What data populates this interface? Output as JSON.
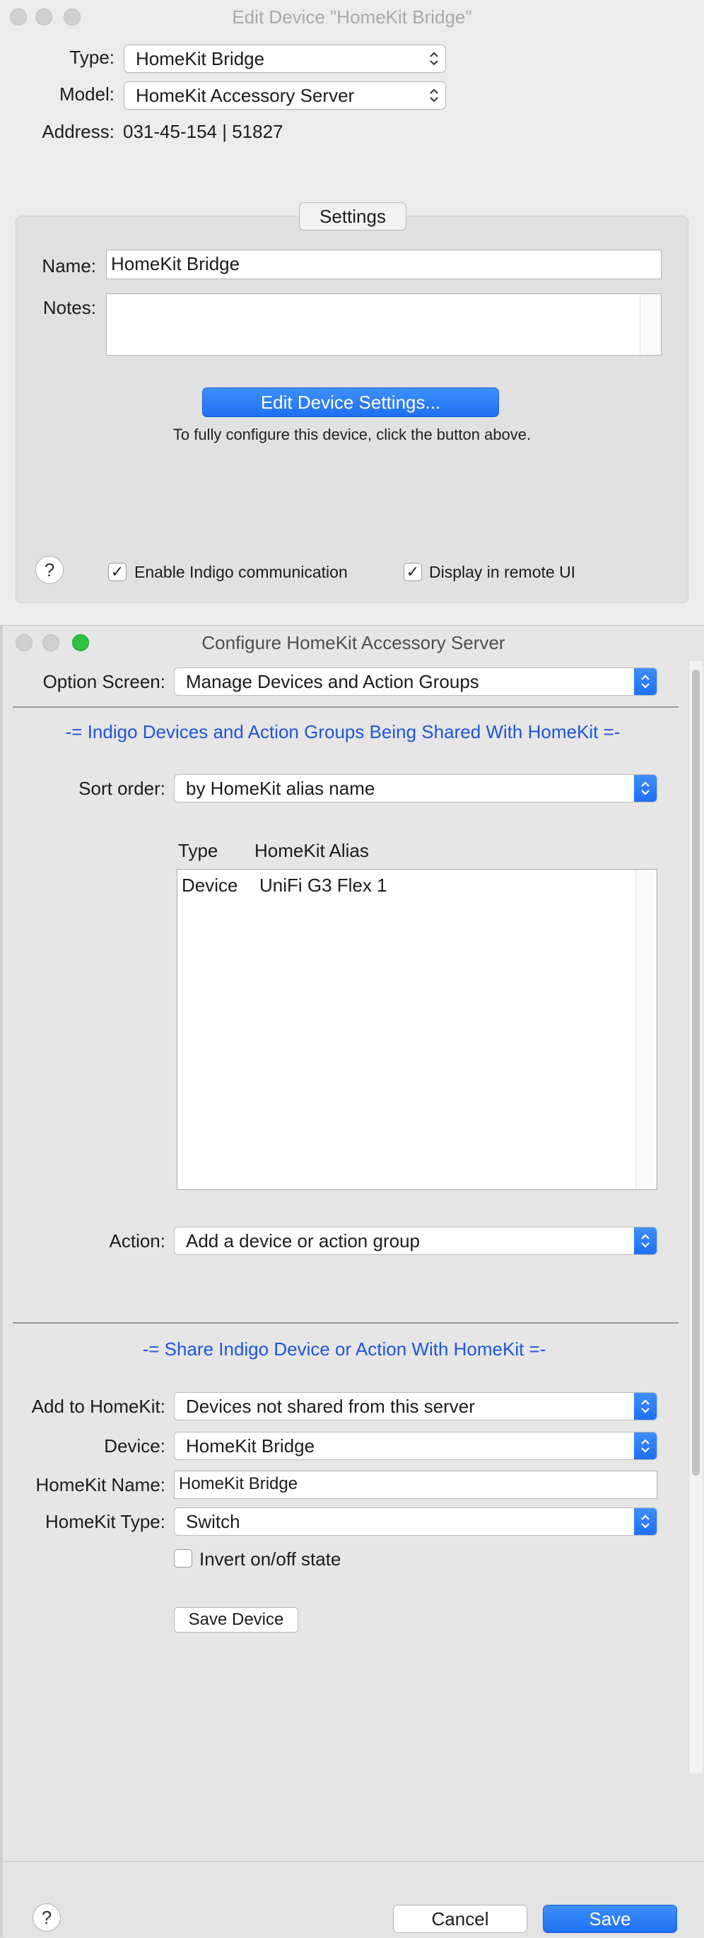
{
  "win1": {
    "title": "Edit Device \"HomeKit Bridge\"",
    "type_label": "Type:",
    "type_value": "HomeKit Bridge",
    "model_label": "Model:",
    "model_value": "HomeKit Accessory Server",
    "address_label": "Address:",
    "address_value": "031-45-154 | 51827",
    "settings_tab": "Settings",
    "name_label": "Name:",
    "name_value": "HomeKit Bridge",
    "notes_label": "Notes:",
    "notes_value": "",
    "edit_button": "Edit Device Settings...",
    "hint": "To fully configure this device, click the button above.",
    "help": "?",
    "enable_comm_label": "Enable Indigo communication",
    "enable_comm_checked": true,
    "remote_ui_label": "Display in remote UI",
    "remote_ui_checked": true,
    "check_glyph": "✓"
  },
  "win2": {
    "title": "Configure HomeKit Accessory Server",
    "option_screen_label": "Option Screen:",
    "option_screen_value": "Manage Devices and Action Groups",
    "section1": "-= Indigo Devices and Action Groups Being Shared With HomeKit =-",
    "sort_label": "Sort order:",
    "sort_value": "by HomeKit alias name",
    "table": {
      "columns": [
        "Type",
        "HomeKit Alias"
      ],
      "rows": [
        {
          "type": "Device",
          "alias": "UniFi G3 Flex 1"
        }
      ]
    },
    "action_label": "Action:",
    "action_value": "Add a device or action group",
    "section2": "-= Share Indigo Device or Action With HomeKit =-",
    "add_label": "Add to HomeKit:",
    "add_value": "Devices not shared from this server",
    "device_label": "Device:",
    "device_value": "HomeKit Bridge",
    "hk_name_label": "HomeKit Name:",
    "hk_name_value": "HomeKit Bridge",
    "hk_type_label": "HomeKit Type:",
    "hk_type_value": "Switch",
    "invert_label": "Invert on/off state",
    "invert_checked": false,
    "save_device": "Save Device",
    "help": "?",
    "cancel": "Cancel",
    "save": "Save"
  },
  "colors": {
    "accent": "#1f6ff2",
    "section_heading": "#1f55dc",
    "traffic_green": "#2fc140"
  }
}
